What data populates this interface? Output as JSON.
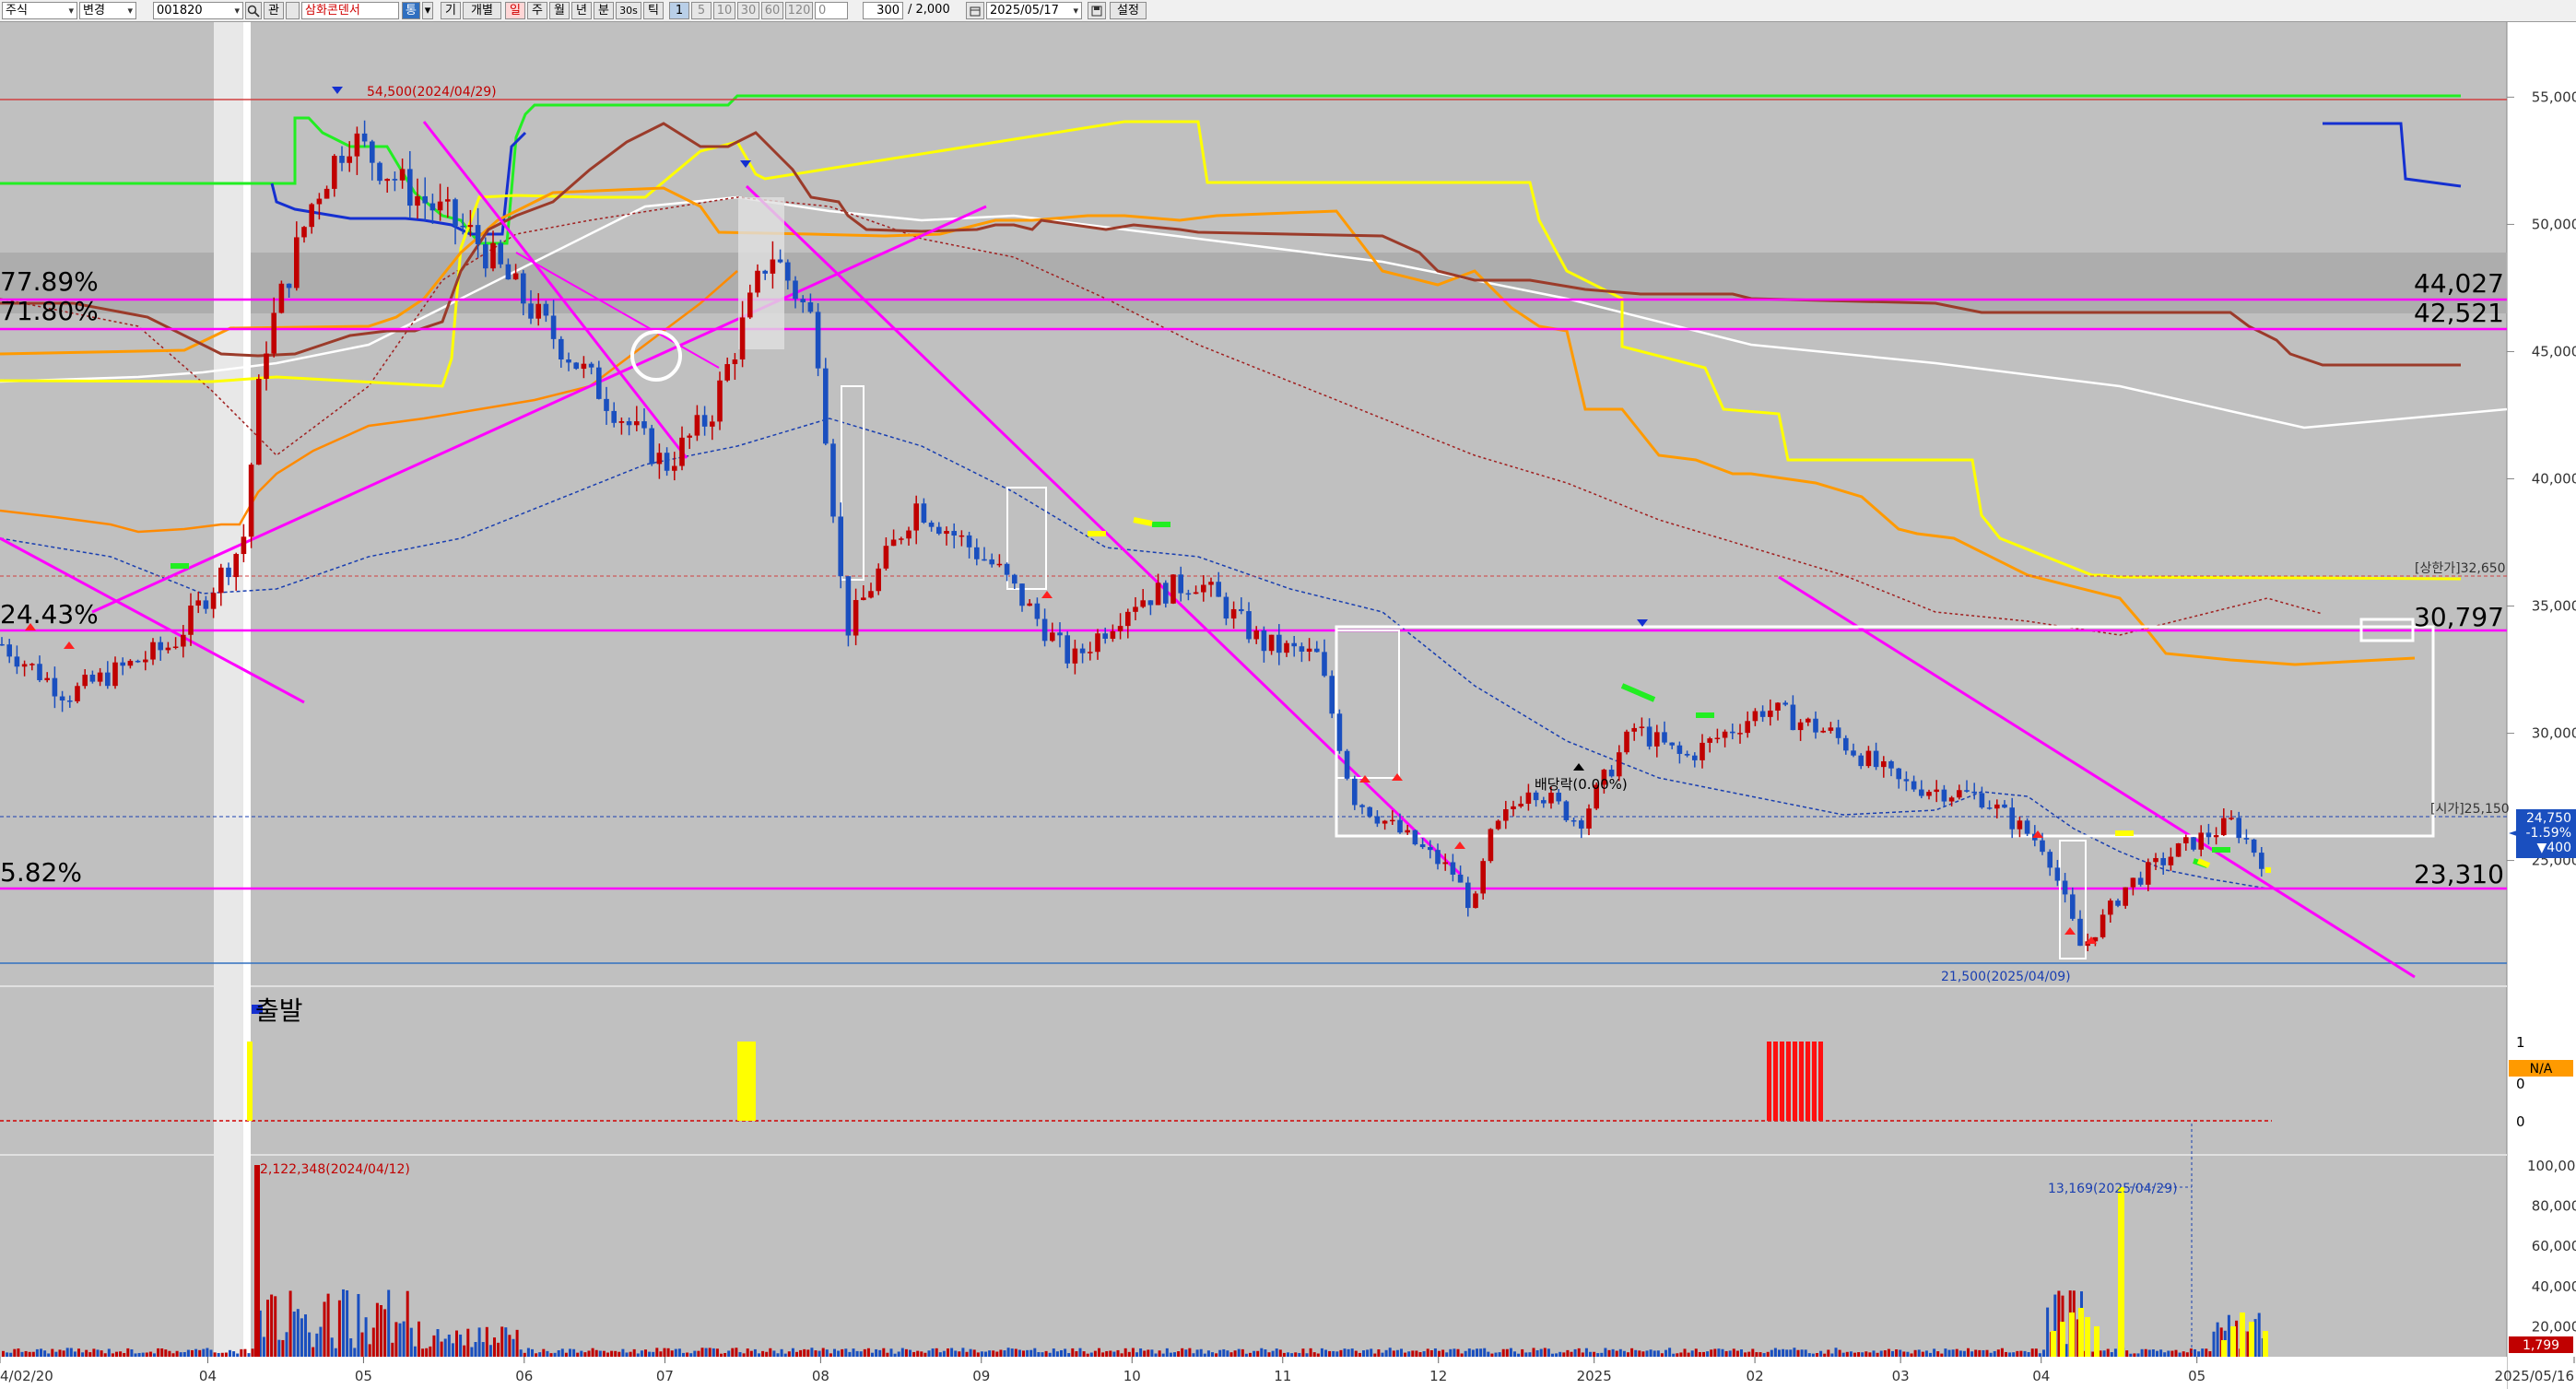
{
  "toolbar": {
    "market": "주식",
    "mode": "변경",
    "code": "001820",
    "search_icon": "search-icon",
    "kwan": "관",
    "name": "삼화콘덴서",
    "tong": "통",
    "ki": "기",
    "gaebyeol": "개별",
    "periods": [
      "일",
      "주",
      "월",
      "년",
      "분",
      "30s",
      "틱"
    ],
    "minutes": [
      "1",
      "5",
      "10",
      "30",
      "60",
      "120"
    ],
    "zero": "0",
    "count": "300",
    "total": "/ 2,000",
    "date": "2025/05/17",
    "save_icon": "save-icon",
    "settings": "설정"
  },
  "colors": {
    "background": "#c0c0c0",
    "up": "#c00000",
    "down": "#1a4fbf",
    "magenta": "#ff00ff",
    "green": "#22ee22",
    "yellow": "#ffff00",
    "orange": "#ff9a00",
    "brown": "#9b3b2a",
    "white": "#ffffff",
    "blue": "#0000d0"
  },
  "chart_data": [
    {
      "type": "candlestick",
      "title": "",
      "xlabel": "",
      "ylabel": "",
      "ylim": [
        21000,
        56500
      ],
      "y_ticks": [
        "55,000",
        "50,000",
        "45,000",
        "40,000",
        "35,000",
        "30,000",
        "25,000"
      ],
      "x_ticks": [
        "4/02/20",
        "04",
        "05",
        "06",
        "07",
        "08",
        "09",
        "10",
        "11",
        "12",
        "2025",
        "02",
        "03",
        "04",
        "05",
        "2025/05/16"
      ],
      "close_points": [
        {
          "x": "2024-02-20",
          "y": 33500
        },
        {
          "x": "2024-03-04",
          "y": 31500
        },
        {
          "x": "2024-03-25",
          "y": 33500
        },
        {
          "x": "2024-04-08",
          "y": 37500
        },
        {
          "x": "2024-04-12",
          "y": 45000
        },
        {
          "x": "2024-04-22",
          "y": 51000
        },
        {
          "x": "2024-04-29",
          "y": 53500
        },
        {
          "x": "2024-05-10",
          "y": 51500
        },
        {
          "x": "2024-05-24",
          "y": 49500
        },
        {
          "x": "2024-06-05",
          "y": 46500
        },
        {
          "x": "2024-06-20",
          "y": 43000
        },
        {
          "x": "2024-07-01",
          "y": 40500
        },
        {
          "x": "2024-07-10",
          "y": 42500
        },
        {
          "x": "2024-07-22",
          "y": 49000
        },
        {
          "x": "2024-07-31",
          "y": 46000
        },
        {
          "x": "2024-08-06",
          "y": 34000
        },
        {
          "x": "2024-08-20",
          "y": 39000
        },
        {
          "x": "2024-09-05",
          "y": 36500
        },
        {
          "x": "2024-09-20",
          "y": 32800
        },
        {
          "x": "2024-10-02",
          "y": 35200
        },
        {
          "x": "2024-10-15",
          "y": 36000
        },
        {
          "x": "2024-10-28",
          "y": 33500
        },
        {
          "x": "2024-11-08",
          "y": 33000
        },
        {
          "x": "2024-11-15",
          "y": 27500
        },
        {
          "x": "2024-11-25",
          "y": 26000
        },
        {
          "x": "2024-12-05",
          "y": 24500
        },
        {
          "x": "2024-12-09",
          "y": 23000
        },
        {
          "x": "2024-12-12",
          "y": 25800
        },
        {
          "x": "2024-12-20",
          "y": 28000
        },
        {
          "x": "2024-12-30",
          "y": 26500
        },
        {
          "x": "2025-01-10",
          "y": 30200
        },
        {
          "x": "2025-01-20",
          "y": 29000
        },
        {
          "x": "2025-02-05",
          "y": 31000
        },
        {
          "x": "2025-02-18",
          "y": 30000
        },
        {
          "x": "2025-03-04",
          "y": 28000
        },
        {
          "x": "2025-03-20",
          "y": 27500
        },
        {
          "x": "2025-04-02",
          "y": 25500
        },
        {
          "x": "2025-04-09",
          "y": 21500
        },
        {
          "x": "2025-04-18",
          "y": 24000
        },
        {
          "x": "2025-04-29",
          "y": 25500
        },
        {
          "x": "2025-05-09",
          "y": 26500
        },
        {
          "x": "2025-05-16",
          "y": 24750
        }
      ],
      "last_price": {
        "price": "24,750",
        "change_pct": "-1.59%",
        "change": "▼400"
      },
      "annotations": [
        "54,500(2024/04/29)",
        "21,500(2025/04/09)",
        "[상한가]32,650",
        "[시가]25,150",
        "배당락(0.00%)"
      ],
      "levels": [
        {
          "pct": "77.89%",
          "price": "44,027"
        },
        {
          "pct": "71.80%",
          "price": "42,521"
        },
        {
          "pct": "24.43%",
          "price": "30,797"
        },
        {
          "pct": "5.82%",
          "price": "23,310"
        }
      ]
    },
    {
      "type": "bar",
      "title": "",
      "label": "출발",
      "y_ticks": [
        "1",
        "0",
        "0"
      ],
      "value_label": "N/A"
    },
    {
      "type": "bar",
      "title": "",
      "ylim": [
        0,
        100000
      ],
      "y_ticks": [
        "100,000",
        "80,000",
        "60,000",
        "40,000",
        "20,000"
      ],
      "annotations": [
        "2,122,348(2024/04/12)",
        "13,169(2025/04/29)"
      ],
      "last_volume": "1,799"
    }
  ]
}
